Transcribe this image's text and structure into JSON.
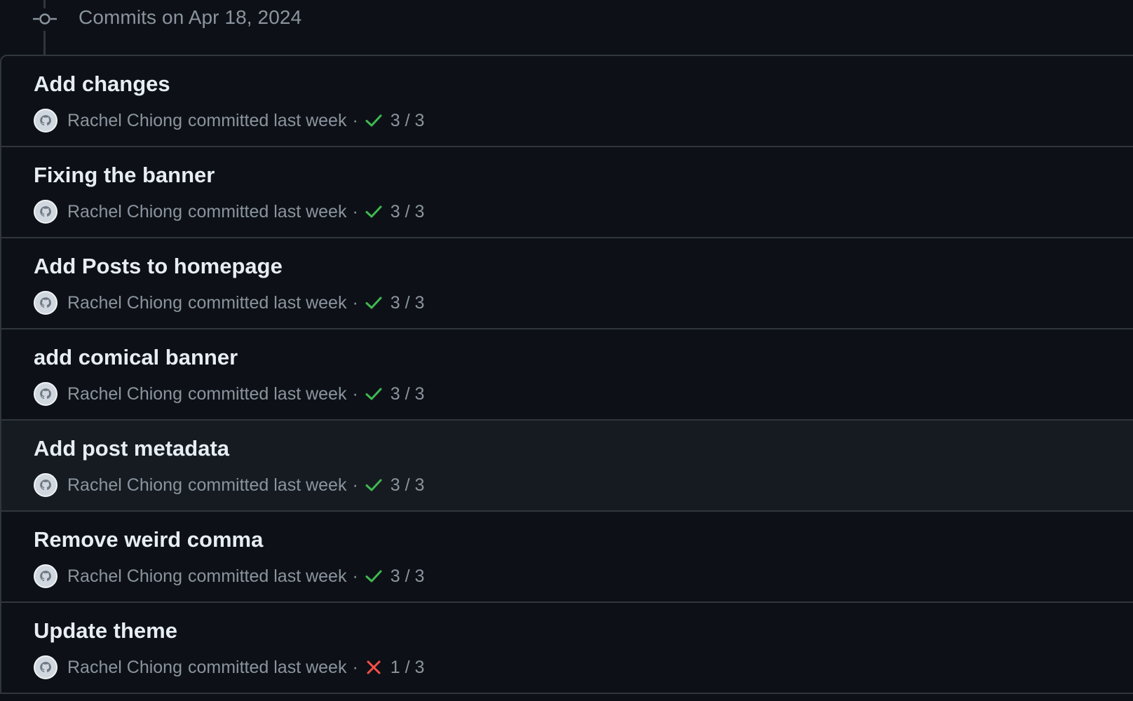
{
  "header": {
    "title": "Commits on Apr 18, 2024"
  },
  "colors": {
    "background": "#0d1117",
    "highlight_row": "#161b22",
    "border": "#30363d",
    "title_text": "#e6edf3",
    "muted_text": "#8b949e",
    "success": "#3fb950",
    "failure": "#f85149"
  },
  "commits": [
    {
      "title": "Add changes",
      "author": "Rachel Chiong",
      "action": "committed last week",
      "separator": "·",
      "status_icon": "check-icon",
      "status": "success",
      "checks": "3 / 3"
    },
    {
      "title": "Fixing the banner",
      "author": "Rachel Chiong",
      "action": "committed last week",
      "separator": "·",
      "status_icon": "check-icon",
      "status": "success",
      "checks": "3 / 3"
    },
    {
      "title": "Add Posts to homepage",
      "author": "Rachel Chiong",
      "action": "committed last week",
      "separator": "·",
      "status_icon": "check-icon",
      "status": "success",
      "checks": "3 / 3"
    },
    {
      "title": "add comical banner",
      "author": "Rachel Chiong",
      "action": "committed last week",
      "separator": "·",
      "status_icon": "check-icon",
      "status": "success",
      "checks": "3 / 3"
    },
    {
      "title": "Add post metadata",
      "author": "Rachel Chiong",
      "action": "committed last week",
      "separator": "·",
      "status_icon": "check-icon",
      "status": "success",
      "checks": "3 / 3",
      "highlighted": true
    },
    {
      "title": "Remove weird comma",
      "author": "Rachel Chiong",
      "action": "committed last week",
      "separator": "·",
      "status_icon": "check-icon",
      "status": "success",
      "checks": "3 / 3"
    },
    {
      "title": "Update theme",
      "author": "Rachel Chiong",
      "action": "committed last week",
      "separator": "·",
      "status_icon": "x-icon",
      "status": "failure",
      "checks": "1 / 3"
    }
  ]
}
